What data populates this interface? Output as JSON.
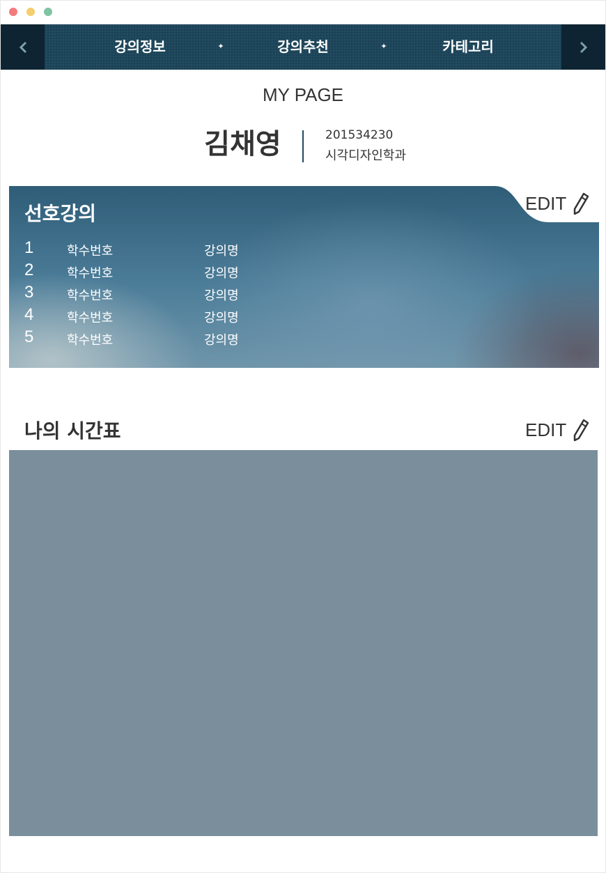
{
  "nav": {
    "prev_icon": "chevron-left-icon",
    "next_icon": "chevron-right-icon",
    "items": [
      {
        "label": "강의정보"
      },
      {
        "label": "강의추천"
      },
      {
        "label": "카테고리"
      }
    ],
    "separator": "✦"
  },
  "page": {
    "title": "MY PAGE"
  },
  "user": {
    "name": "김채영",
    "student_id": "201534230",
    "department": "시각디자인학과"
  },
  "favorites": {
    "title": "선호강의",
    "edit_label": "EDIT",
    "edit_icon": "pencil-icon",
    "rows": [
      {
        "num": "1",
        "code": "학수번호",
        "name": "강의명"
      },
      {
        "num": "2",
        "code": "학수번호",
        "name": "강의명"
      },
      {
        "num": "3",
        "code": "학수번호",
        "name": "강의명"
      },
      {
        "num": "4",
        "code": "학수번호",
        "name": "강의명"
      },
      {
        "num": "5",
        "code": "학수번호",
        "name": "강의명"
      }
    ]
  },
  "timetable": {
    "title": "나의 시간표",
    "edit_label": "EDIT",
    "edit_icon": "pencil-icon"
  },
  "colors": {
    "nav_bg": "#1c4459",
    "nav_arrow_bg": "#0e2433",
    "timetable_bg": "#7a8f9b",
    "text": "#333333"
  }
}
